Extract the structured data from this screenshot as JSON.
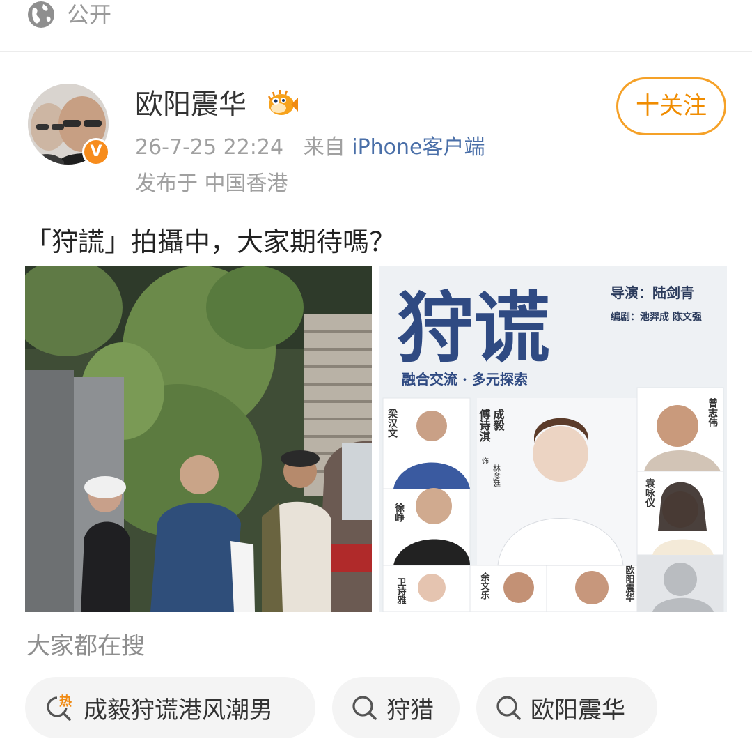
{
  "header": {
    "visibility_label": "公开",
    "visibility_icon": "globe-icon"
  },
  "author": {
    "name": "欧阳震华",
    "verified_badge": "V",
    "fan_badge_icon": "pufferfish-icon",
    "timestamp": "26-7-25 22:24",
    "source_prefix": "来自",
    "source": "iPhone客户端",
    "location": "发布于 中国香港",
    "follow_label": "十关注"
  },
  "post": {
    "text": "「狩謊」拍攝中，大家期待嗎？"
  },
  "poster": {
    "title": "狩谎",
    "director": "导演：陆剑青",
    "writers": "编剧：池羿成  陈文强",
    "tagline": "融合交流 · 多元探索",
    "cast": [
      {
        "name": "梁汉文"
      },
      {
        "name": "傅诗淇"
      },
      {
        "name": "成毅"
      },
      {
        "name": "林彦廷"
      },
      {
        "name": "曾志伟"
      },
      {
        "name": "徐峥"
      },
      {
        "name": "袁咏仪"
      },
      {
        "name": "卫诗雅"
      },
      {
        "name": "余文乐"
      },
      {
        "name": "欧阳震华"
      }
    ],
    "role_note": "饰"
  },
  "search": {
    "heading": "大家都在搜",
    "chips": [
      {
        "label": "成毅狩谎港风潮男",
        "icon": "hot-search-icon"
      },
      {
        "label": "狩猎",
        "icon": "search-icon"
      },
      {
        "label": "欧阳震华",
        "icon": "search-icon"
      }
    ]
  },
  "colors": {
    "accent": "#f5a128",
    "link": "#4a6fa8",
    "muted": "#a0a0a0",
    "badge": "#f78c1c"
  }
}
